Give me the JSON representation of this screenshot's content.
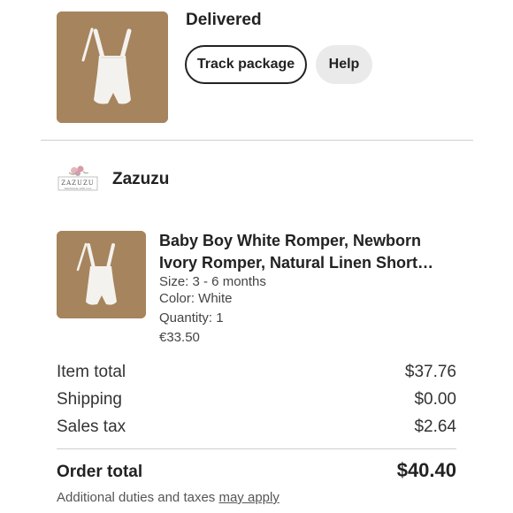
{
  "order": {
    "status": "Delivered",
    "track_label": "Track package",
    "help_label": "Help"
  },
  "shop": {
    "name": "Zazuzu",
    "logo_text": "ZAZUZU",
    "logo_tagline": "handmade with love"
  },
  "item": {
    "title_line1": "Baby Boy White Romper, Newborn",
    "title_line2": "Ivory Romper, Natural Linen Short…",
    "size": "Size: 3 - 6 months",
    "color": "Color: White",
    "quantity": "Quantity: 1",
    "price": "€33.50"
  },
  "totals": {
    "rows": [
      {
        "label": "Item total",
        "value": "$37.76"
      },
      {
        "label": "Shipping",
        "value": "$0.00"
      },
      {
        "label": "Sales tax",
        "value": "$2.64"
      }
    ],
    "order_total_label": "Order total",
    "order_total_value": "$40.40",
    "footnote_prefix": "Additional duties and taxes",
    "footnote_link": "may apply"
  },
  "colors": {
    "photo_background": "#a1805a",
    "button_secondary": "#eaeaea",
    "divider": "#cfcfcf"
  },
  "icons": [
    "romper-product-photo",
    "shop-logo"
  ]
}
